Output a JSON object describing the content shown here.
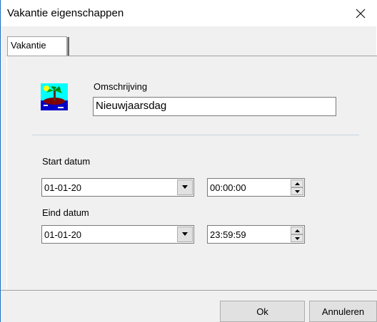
{
  "window": {
    "title": "Vakantie eigenschappen"
  },
  "tabs": [
    {
      "label": "Vakantie"
    }
  ],
  "description": {
    "label": "Omschrijving",
    "value": "Nieuwjaarsdag"
  },
  "start": {
    "label": "Start datum",
    "date": "01-01-20",
    "time": "00:00:00"
  },
  "end": {
    "label": "Eind datum",
    "date": "01-01-20",
    "time": "23:59:59"
  },
  "buttons": {
    "ok": "Ok",
    "cancel": "Annuleren"
  },
  "icons": {
    "close": "close-icon",
    "holiday": "holiday-island-icon",
    "dropdown": "chevron-down-icon"
  },
  "colors": {
    "accent_border": "#1e6fc6",
    "separator": "#c7d4e0"
  }
}
